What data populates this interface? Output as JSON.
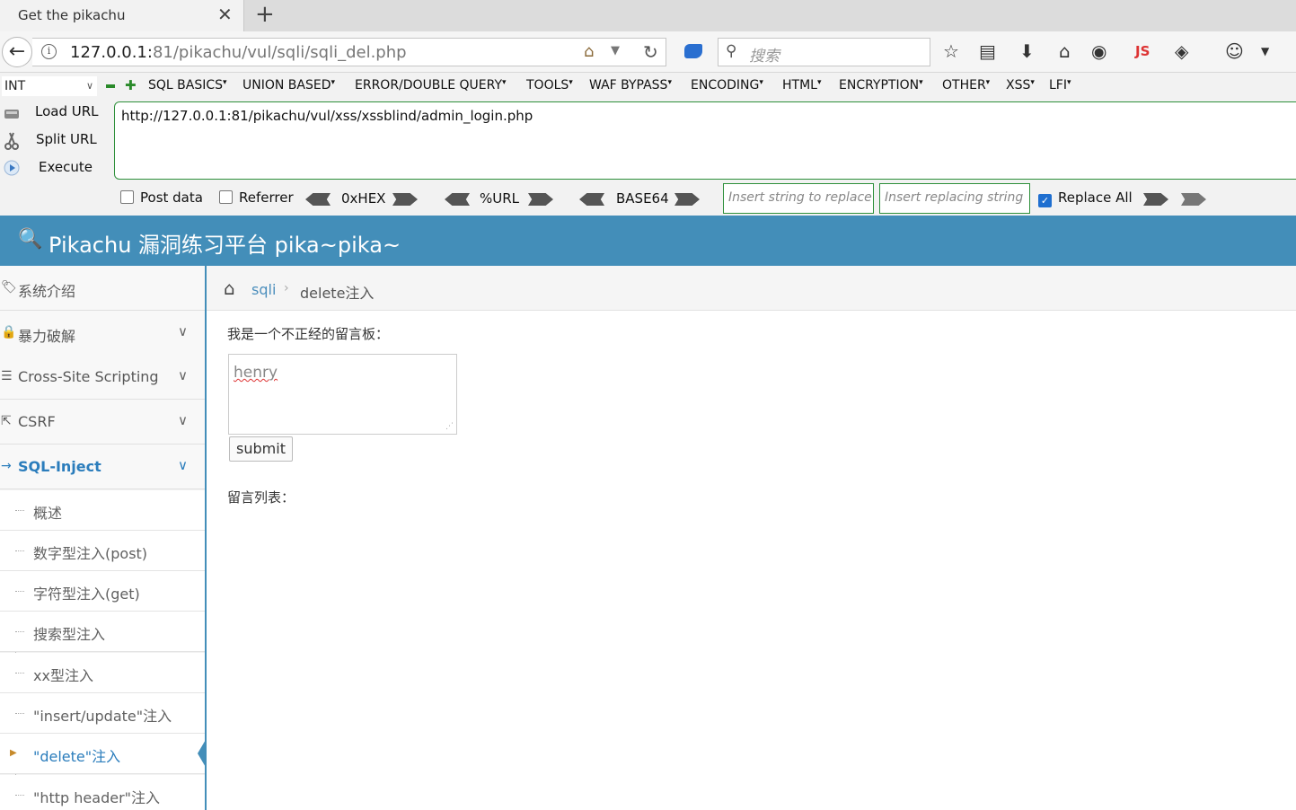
{
  "browser": {
    "tab_title": "Get the pikachu",
    "tab_close": "✕",
    "new_tab": "+",
    "url_host": "127.0.0.1:",
    "url_rest": "81/pikachu/vul/sqli/sqli_del.php",
    "search_placeholder": "搜索",
    "js_label": "JS"
  },
  "hackbar": {
    "type_select": "INT",
    "menu": [
      "SQL BASICS",
      "UNION BASED",
      "ERROR/DOUBLE QUERY",
      "TOOLS",
      "WAF BYPASS",
      "ENCODING",
      "HTML",
      "ENCRYPTION",
      "OTHER",
      "XSS",
      "LFI"
    ],
    "load_url": "Load URL",
    "split_url": "Split URL",
    "execute": "Execute",
    "url_value": "http://127.0.0.1:81/pikachu/vul/xss/xssblind/admin_login.php",
    "post_data": "Post data",
    "referrer": "Referrer",
    "hex": "0xHEX",
    "urlenc": "%URL",
    "base64": "BASE64",
    "replace_placeholder": "Insert string to replace",
    "replacing_placeholder": "Insert replacing string",
    "replace_all": "Replace All",
    "replace_all_checked": true
  },
  "site": {
    "title": "Pikachu 漏洞练习平台 pika~pika~",
    "accent_color": "#438eb9"
  },
  "sidebar": {
    "items": [
      {
        "label": "系统介绍",
        "icon": "tag-icon"
      },
      {
        "label": "暴力破解",
        "icon": "lock-icon"
      },
      {
        "label": "Cross-Site Scripting",
        "icon": "list-icon"
      },
      {
        "label": "CSRF",
        "icon": "share-icon"
      },
      {
        "label": "SQL-Inject",
        "icon": "arrow-icon"
      }
    ],
    "sub_items": [
      "概述",
      "数字型注入(post)",
      "字符型注入(get)",
      "搜索型注入",
      "xx型注入",
      "\"insert/update\"注入",
      "\"delete\"注入",
      "\"http header\"注入"
    ]
  },
  "breadcrumb": {
    "link": "sqli",
    "current": "delete注入"
  },
  "main": {
    "board_label": "我是一个不正经的留言板：",
    "message_value": "henry",
    "submit_label": "submit",
    "list_label": "留言列表："
  }
}
